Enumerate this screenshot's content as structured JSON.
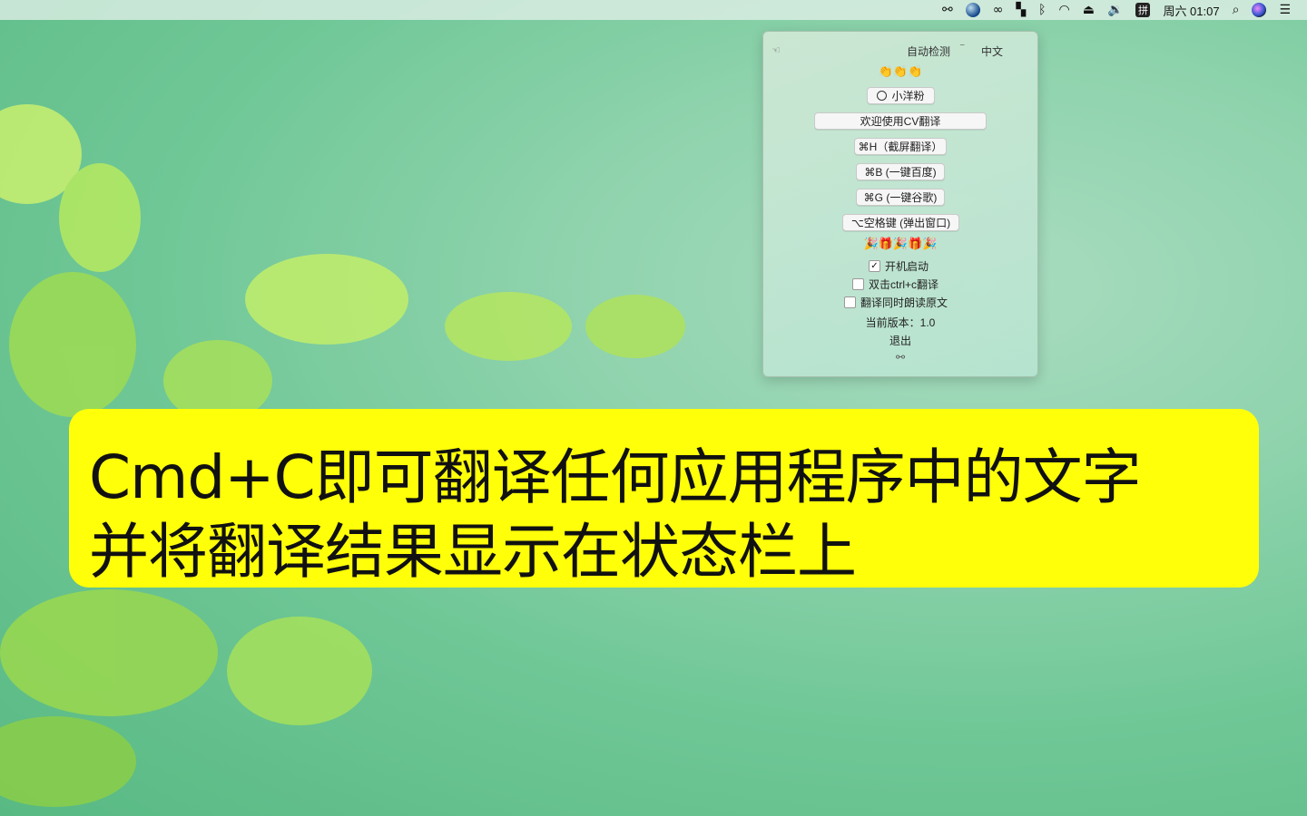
{
  "menubar": {
    "clock": "周六 01:07",
    "input_method": "拼",
    "icons": [
      "translator-icon",
      "globe-icon",
      "creative-cloud-icon",
      "window-manager-icon",
      "bluetooth-icon",
      "wifi-icon",
      "eject-icon",
      "volume-icon",
      "input-method-icon",
      "search-icon",
      "siri-icon",
      "control-center-icon"
    ]
  },
  "popover": {
    "source_lang": "自动检测",
    "target_lang": "中文",
    "emoji_top": "👏👏👏",
    "github_button": "小洋粉",
    "welcome_button": "欢迎使用CV翻译",
    "shortcuts": [
      "⌘H（截屏翻译）",
      "⌘B (一键百度)",
      "⌘G (一键谷歌)",
      "⌥空格键 (弹出窗口)"
    ],
    "emoji_mid": "🎉🎁🎉🎁🎉",
    "options": [
      {
        "label": "开机启动",
        "checked": true
      },
      {
        "label": "双击ctrl+c翻译",
        "checked": false
      },
      {
        "label": "翻译同时朗读原文",
        "checked": false
      }
    ],
    "version": "当前版本：1.0",
    "quit": "退出"
  },
  "banner": {
    "line1": "Cmd+C即可翻译任何应用程序中的文字",
    "line2": "并将翻译结果显示在状态栏上"
  },
  "colors": {
    "banner_bg": "#ffff0a",
    "wallpaper": "#6fc796"
  }
}
